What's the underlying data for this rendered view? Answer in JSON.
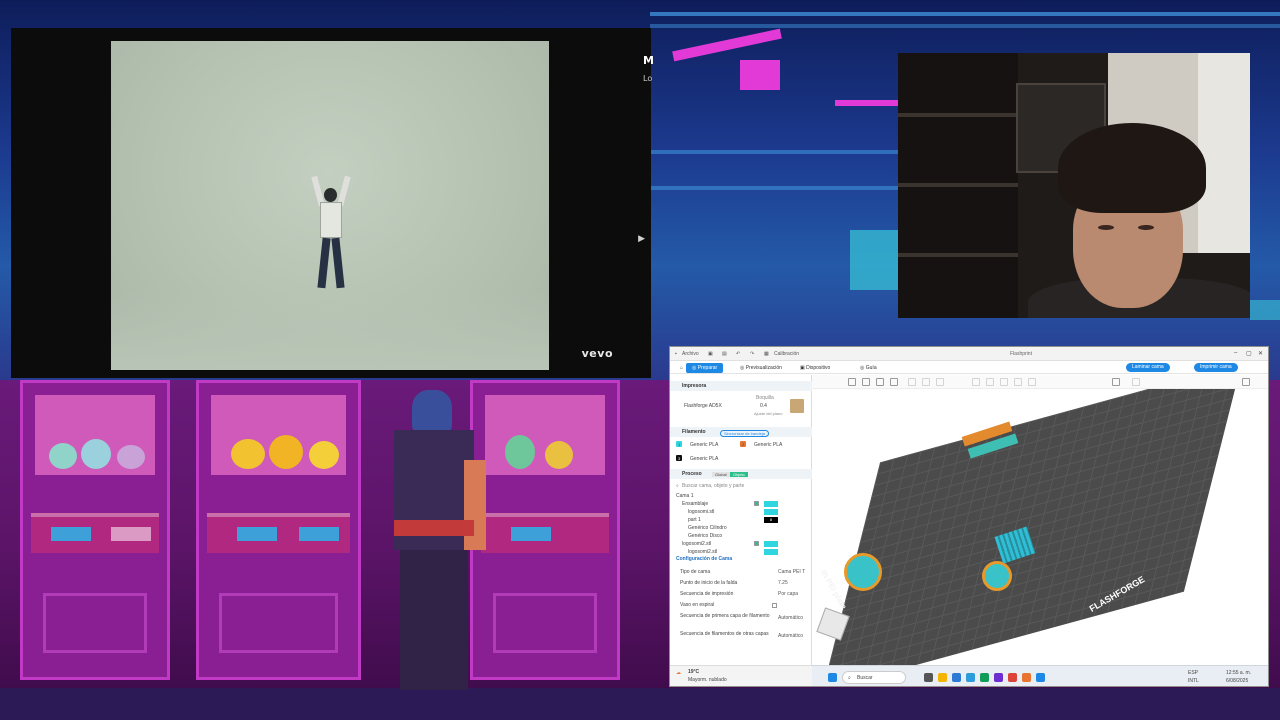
{
  "video": {
    "watermark": "vevo",
    "side_title_initial": "M",
    "side_subtitle_initial": "Lo",
    "next_icon": "play-next-icon"
  },
  "slicer": {
    "titlebar": {
      "menu_archivo": "Archivo",
      "menu_calibration": "Calibración",
      "window_title": "Flashprint"
    },
    "tabs": {
      "prepare": "Preparar",
      "preview": "Previsualización",
      "device": "Dispositivo",
      "guide": "Guía"
    },
    "actions": {
      "slice": "Laminar cama",
      "print": "Imprimir cama"
    },
    "printer_section": {
      "title": "Impresora",
      "printer_name": "Flashforge AD5X",
      "nozzle_label": "Boquilla",
      "nozzle_value": "0.4",
      "plate_hint": "Ajuste del plano"
    },
    "filament_section": {
      "title": "Filamento",
      "sync_button": "Sincronizar de bandeja",
      "slot1_number": "1",
      "slot1_material": "Generic PLA",
      "slot2_number": "2",
      "slot2_material": "Generic PLA",
      "slot3_number": "3",
      "slot3_material": "Generic PLA"
    },
    "process_section": {
      "title": "Proceso",
      "mode_global": "Global",
      "mode_object": "Objeto",
      "search_placeholder": "Buscar cama, objeto y parte"
    },
    "tree": {
      "bed": "Cama 1",
      "obj1": "Ensamblaje",
      "obj1_part1": "logosomi.stl",
      "obj1_part2": "part 1",
      "obj1_part3": "Genérico Cilindro",
      "obj1_part4": "Genérico Disco",
      "obj2": "logosomi2.stl",
      "obj2_part1": "logosomi2.stl",
      "black_chip_label": "8"
    },
    "bed_config": {
      "title": "Configuración de Cama",
      "rows": [
        {
          "label": "Tipo de cama",
          "value": "Cama PEI T"
        },
        {
          "label": "Punto de inicio de la falda",
          "value": "7.25"
        },
        {
          "label": "Secuencia de impresión",
          "value": "Por capa"
        },
        {
          "label": "Vaso en espiral",
          "value": ""
        },
        {
          "label": "Secuencia de primera capa de filamento",
          "value": "Automático"
        },
        {
          "label": "Secuencia de filamentos de otras capas",
          "value": "Automático"
        }
      ]
    },
    "plate": {
      "brand": "FLASHFORGE",
      "plate_name": "th PEI plate"
    },
    "status": {
      "temperature": "19°C",
      "weather": "Mayorm. nublado"
    },
    "taskbar": {
      "search_label": "Buscar",
      "lang_top": "ESP",
      "lang_bottom": "INTL",
      "time": "12:55 a. m.",
      "date": "6/08/2025"
    }
  },
  "colors": {
    "accent": "#1e88e5",
    "filament_cyan": "#2fd6e0",
    "filament_orange": "#e8742d",
    "plate_dark": "#4b4b4b"
  }
}
